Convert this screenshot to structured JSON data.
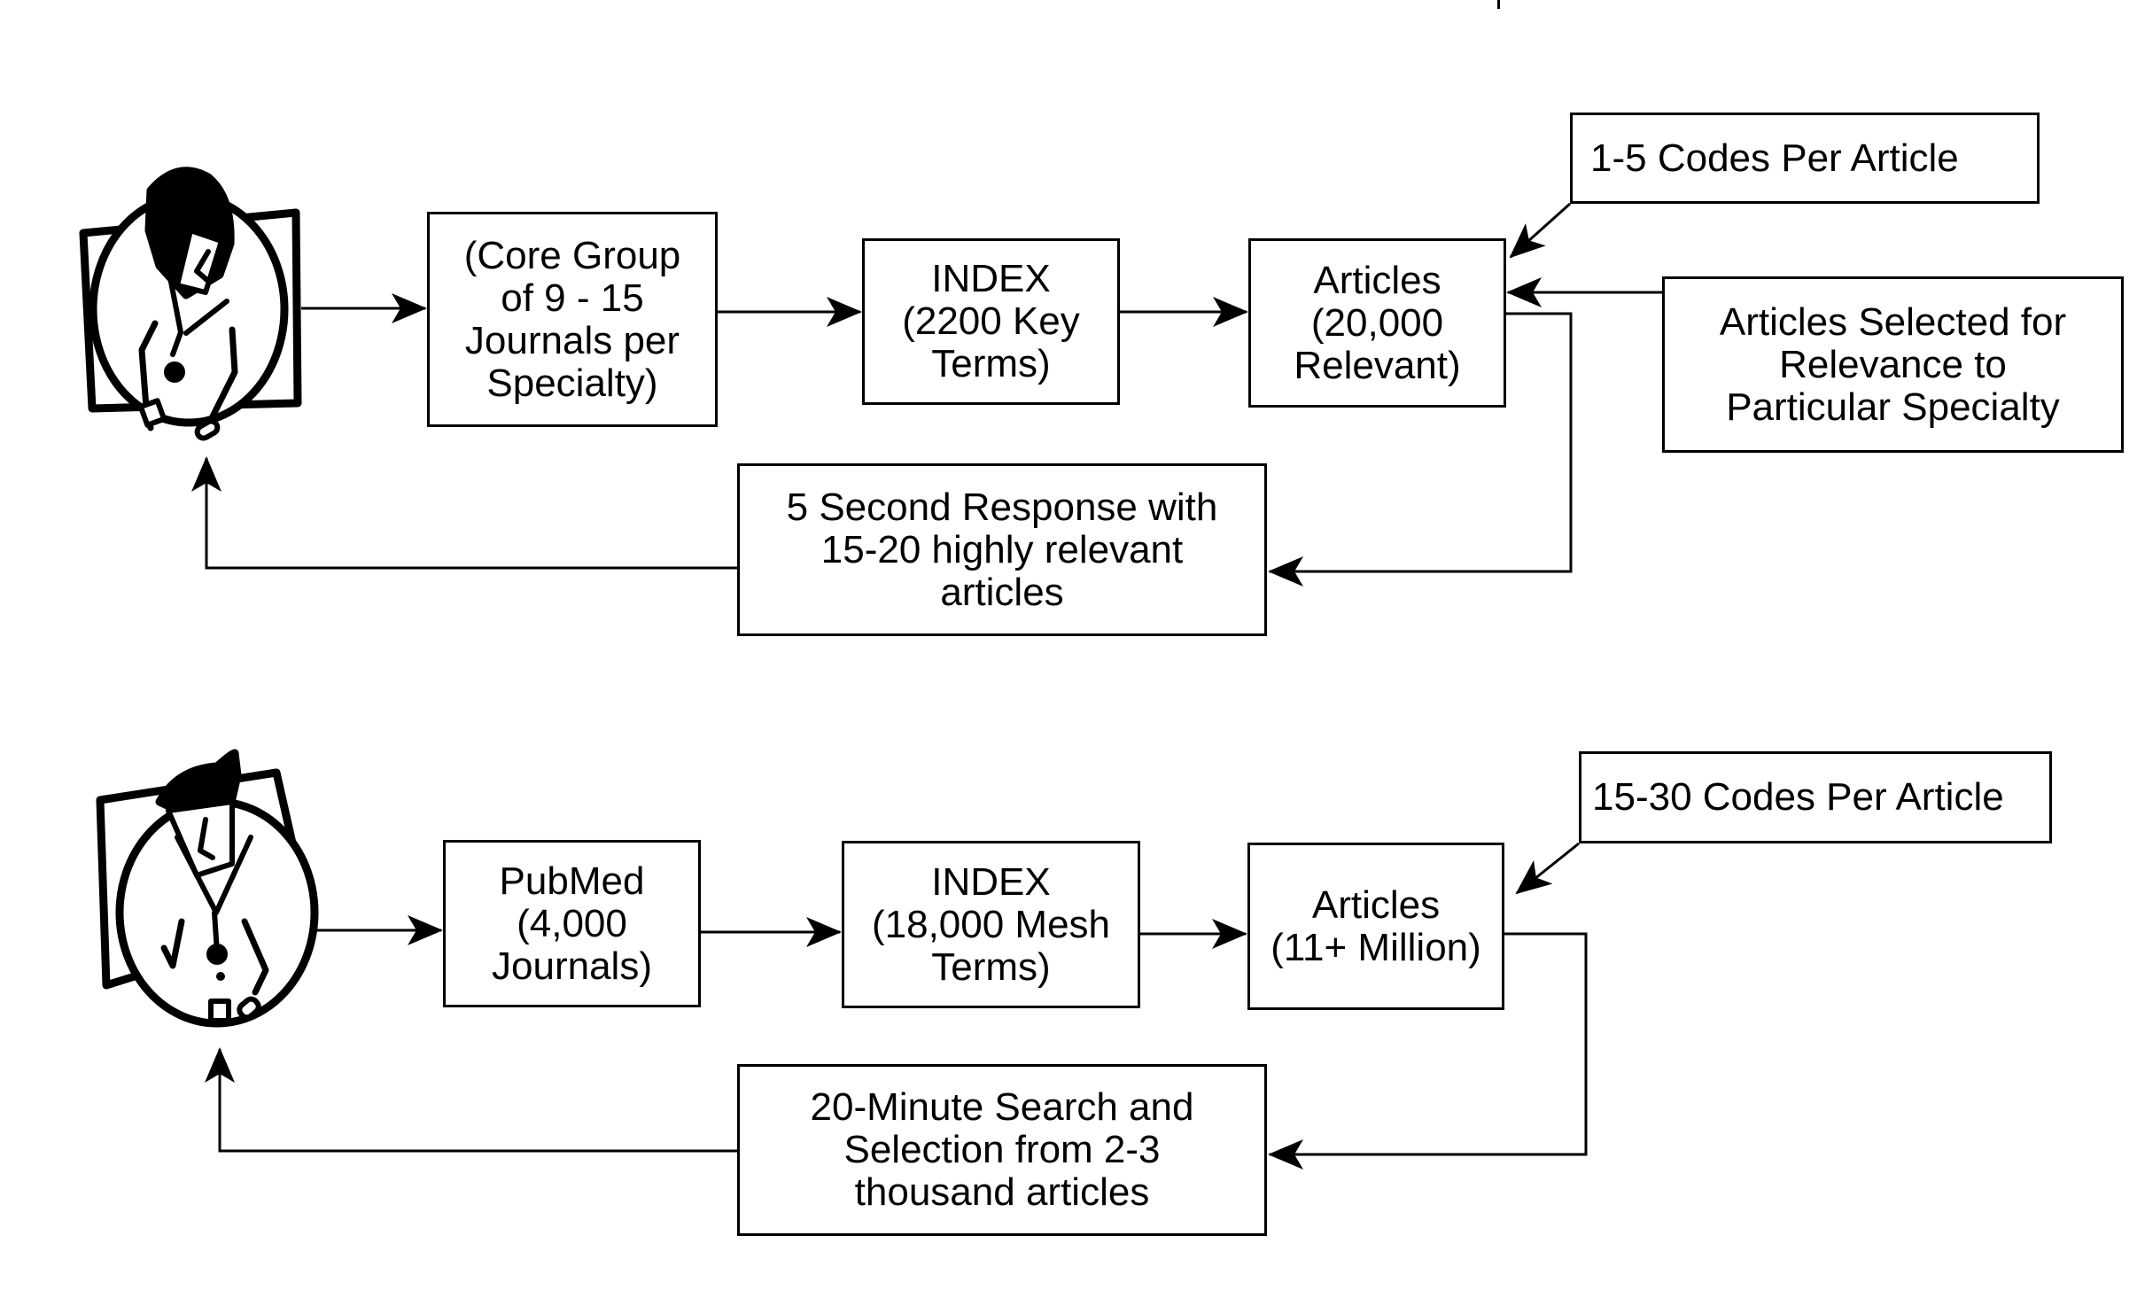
{
  "diagram": {
    "colors": {
      "stroke": "#000000",
      "background": "#ffffff"
    },
    "top_flow": {
      "user_icon": "physician-icon",
      "source": "(Core Group\nof 9 - 15\nJournals per\nSpecialty)",
      "index": "INDEX\n(2200 Key\nTerms)",
      "articles": "Articles\n(20,000\nRelevant)",
      "codes_note": "1-5 Codes Per Article",
      "selection_note": "Articles Selected for\nRelevance to\nParticular Specialty",
      "response": "5 Second Response with\n15-20 highly relevant\narticles"
    },
    "bottom_flow": {
      "user_icon": "physician-icon",
      "source": "PubMed\n(4,000\nJournals)",
      "index": "INDEX\n(18,000 Mesh\nTerms)",
      "articles": "Articles\n(11+ Million)",
      "codes_note": "15-30 Codes Per Article",
      "response": "20-Minute Search and\nSelection from 2-3\nthousand articles"
    }
  }
}
